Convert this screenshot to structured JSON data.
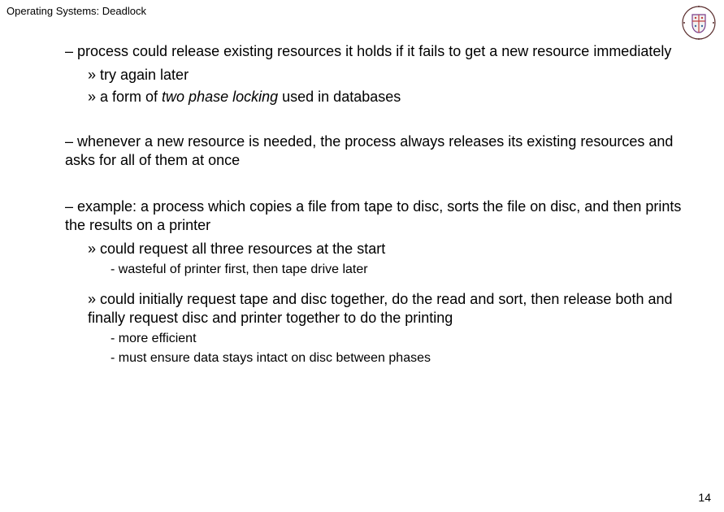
{
  "header": {
    "title": "Operating Systems: Deadlock"
  },
  "logo": {
    "name": "university-crest"
  },
  "body": {
    "p1": "– process could release existing resources it holds if it fails to get a new resource immediately",
    "p1a": "» try again later",
    "p1b_prefix": "» a form of ",
    "p1b_italic": "two phase locking",
    "p1b_suffix": " used in databases",
    "p2": "– whenever a new resource is needed, the process always releases its existing resources and asks for all of them at once",
    "p3": "– example: a process which copies a file from tape to disc, sorts the file on disc, and then prints the results on a printer",
    "p3a": "» could request all three resources at the start",
    "p3a1": "-  wasteful of printer first, then tape drive later",
    "p3b": "» could initially request tape and disc together, do the read and sort, then release both and finally request disc and printer together to do the printing",
    "p3b1": "-  more efficient",
    "p3b2": "-  must ensure data stays intact on disc between phases"
  },
  "footer": {
    "page_number": "14"
  }
}
